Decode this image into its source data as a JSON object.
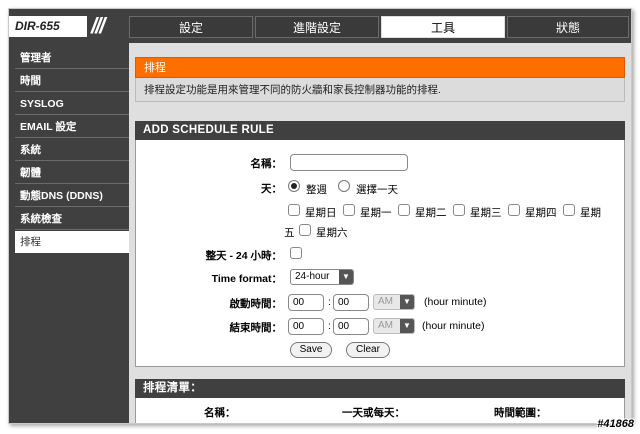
{
  "brand": {
    "model": "DIR-655",
    "slashes": "///"
  },
  "tabs": [
    {
      "label": "設定"
    },
    {
      "label": "進階設定"
    },
    {
      "label": "工具"
    },
    {
      "label": "狀態"
    }
  ],
  "sidebar": {
    "items": [
      {
        "label": "管理者"
      },
      {
        "label": "時間"
      },
      {
        "label": "SYSLOG"
      },
      {
        "label": "EMAIL 設定"
      },
      {
        "label": "系統"
      },
      {
        "label": "韌體"
      },
      {
        "label": "動態DNS (DDNS)"
      },
      {
        "label": "系統檢查"
      },
      {
        "label": "排程"
      }
    ]
  },
  "page": {
    "title": "排程",
    "description": "排程設定功能是用來管理不同的防火牆和家長控制器功能的排程."
  },
  "add_rule": {
    "heading": "ADD SCHEDULE RULE",
    "name_label": "名稱：",
    "name_value": "",
    "day_label": "天：",
    "radio_week": "整週",
    "radio_select": "選擇一天",
    "days": {
      "sun": "星期日",
      "mon": "星期一",
      "tue": "星期二",
      "wed": "星期三",
      "thu": "星期四",
      "fri_part1": "星期",
      "fri_part2": "五",
      "sat": "星期六"
    },
    "allday_label": "整天 - 24 小時：",
    "time_format_label": "Time format：",
    "time_format_value": "24-hour",
    "start_label": "啟動時間：",
    "start_hour": "00",
    "start_minute": "00",
    "start_ampm": "AM",
    "end_label": "結束時間：",
    "end_hour": "00",
    "end_minute": "00",
    "end_ampm": "AM",
    "colon": ":",
    "hint": "(hour minute)",
    "save": "Save",
    "clear": "Clear"
  },
  "list": {
    "heading": "排程清單：",
    "col_name": "名稱：",
    "col_day": "一天或每天：",
    "col_time": "時間範圍："
  },
  "watermark": "#41868",
  "colors": {
    "accent": "#ff6f00",
    "dark": "#404040",
    "panel": "#dfdfdf"
  }
}
